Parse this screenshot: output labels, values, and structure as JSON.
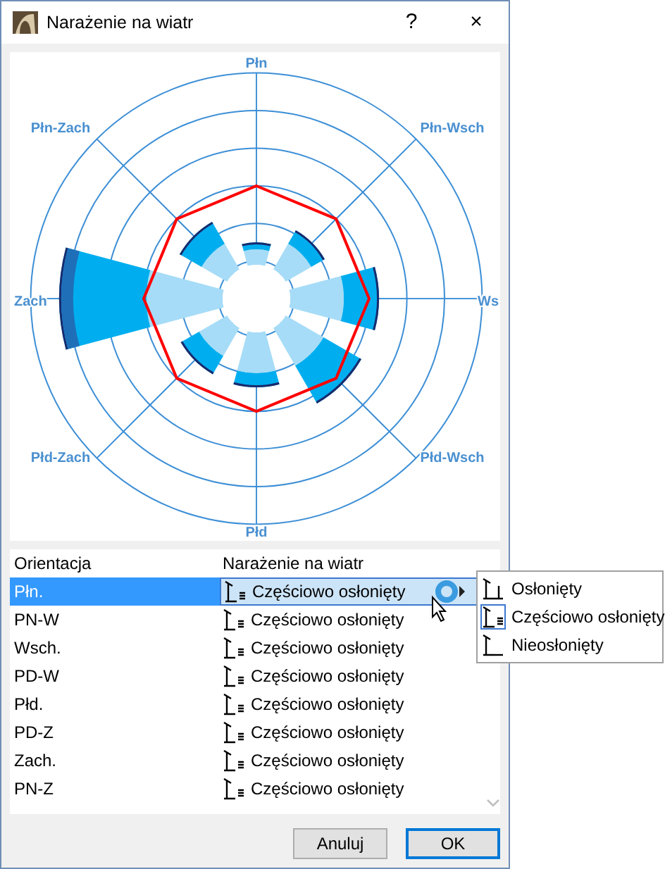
{
  "window": {
    "title": "Narażenie na wiatr",
    "help": "?",
    "close": "×"
  },
  "wind_rose": {
    "labels": [
      "Płn",
      "Płn-Wsch",
      "Ws",
      "Płd-Wsch",
      "Płd",
      "Płd-Zach",
      "Zach",
      "Płn-Zach"
    ]
  },
  "table": {
    "columns": [
      "Orientacja",
      "Narażenie na wiatr"
    ],
    "rows": [
      {
        "orientation": "Płn.",
        "exposure": "Częściowo osłonięty",
        "kind": "partial",
        "selected": true
      },
      {
        "orientation": "PN-W",
        "exposure": "Częściowo osłonięty",
        "kind": "partial",
        "selected": false
      },
      {
        "orientation": "Wsch.",
        "exposure": "Częściowo osłonięty",
        "kind": "partial",
        "selected": false
      },
      {
        "orientation": "PD-W",
        "exposure": "Częściowo osłonięty",
        "kind": "partial",
        "selected": false
      },
      {
        "orientation": "Płd.",
        "exposure": "Częściowo osłonięty",
        "kind": "partial",
        "selected": false
      },
      {
        "orientation": "PD-Z",
        "exposure": "Częściowo osłonięty",
        "kind": "partial",
        "selected": false
      },
      {
        "orientation": "Zach.",
        "exposure": "Częściowo osłonięty",
        "kind": "partial",
        "selected": false
      },
      {
        "orientation": "PN-Z",
        "exposure": "Częściowo osłonięty",
        "kind": "partial",
        "selected": false
      }
    ]
  },
  "dropdown": {
    "options": [
      {
        "label": "Osłonięty",
        "kind": "sheltered",
        "selected": false
      },
      {
        "label": "Częściowo osłonięty",
        "kind": "partial",
        "selected": true
      },
      {
        "label": "Nieosłonięty",
        "kind": "open",
        "selected": false
      }
    ]
  },
  "buttons": [
    {
      "label": "Anuluj",
      "default": false
    },
    {
      "label": "OK",
      "default": true
    }
  ]
}
